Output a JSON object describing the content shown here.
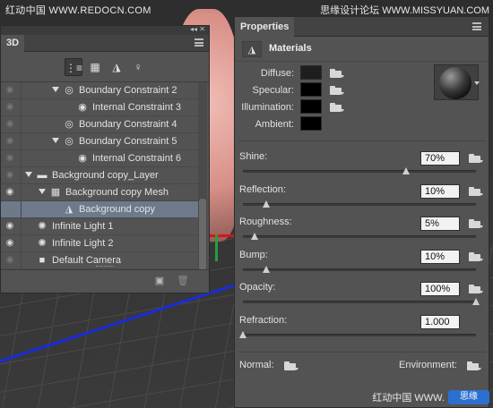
{
  "watermarks": {
    "top_left": "红动中国 WWW.REDOCN.COM",
    "top_right": "思缘设计论坛 WWW.MISSYUAN.COM",
    "bottom_right": "红动中国 WWW.",
    "bottom_badge": "思缘"
  },
  "panel3d": {
    "tab_label": "3D",
    "toolbar": [
      {
        "name": "scene-filter-icon",
        "glyph": "⋮≡"
      },
      {
        "name": "meshes-filter-icon",
        "glyph": "▦"
      },
      {
        "name": "materials-filter-icon",
        "glyph": "◮"
      },
      {
        "name": "lights-filter-icon",
        "glyph": "♀"
      }
    ],
    "rows": [
      {
        "label": "Boundary Constraint 2",
        "icon": "constraint-icon",
        "glyph": "◎",
        "expanded": true,
        "level": 2,
        "visible": false,
        "selected": false
      },
      {
        "label": "Internal Constraint 3",
        "icon": "constraint-icon",
        "glyph": "◉",
        "expanded": false,
        "level": 3,
        "visible": false,
        "selected": false
      },
      {
        "label": "Boundary Constraint 4",
        "icon": "constraint-icon",
        "glyph": "◎",
        "expanded": false,
        "level": 2,
        "visible": false,
        "selected": false
      },
      {
        "label": "Boundary Constraint 5",
        "icon": "constraint-icon",
        "glyph": "◎",
        "expanded": true,
        "level": 2,
        "visible": false,
        "selected": false
      },
      {
        "label": "Internal Constraint 6",
        "icon": "constraint-icon",
        "glyph": "◉",
        "expanded": false,
        "level": 3,
        "visible": false,
        "selected": false
      },
      {
        "label": "Background copy_Layer",
        "icon": "folder-icon",
        "glyph": "▬",
        "expanded": true,
        "level": 0,
        "visible": false,
        "selected": false
      },
      {
        "label": "Background copy Mesh",
        "icon": "mesh-icon",
        "glyph": "▦",
        "expanded": true,
        "level": 1,
        "visible": true,
        "selected": false
      },
      {
        "label": "Background copy",
        "icon": "material-icon",
        "glyph": "◮",
        "expanded": false,
        "level": 2,
        "visible": false,
        "selected": true
      },
      {
        "label": "Infinite Light 1",
        "icon": "light-icon",
        "glyph": "✺",
        "expanded": false,
        "level": 0,
        "visible": true,
        "selected": false
      },
      {
        "label": "Infinite Light 2",
        "icon": "light-icon",
        "glyph": "✺",
        "expanded": false,
        "level": 0,
        "visible": true,
        "selected": false
      },
      {
        "label": "Default Camera",
        "icon": "camera-icon",
        "glyph": "■",
        "expanded": false,
        "level": 0,
        "visible": false,
        "selected": false
      }
    ],
    "footer": {
      "new_glyph": "▣",
      "delete_glyph": "🗑"
    }
  },
  "properties": {
    "tab_label": "Properties",
    "header_title": "Materials",
    "header_glyph": "◮",
    "colors": [
      {
        "label": "Diffuse:",
        "swatch": "#1e1e1e"
      },
      {
        "label": "Specular:",
        "swatch": "#000000"
      },
      {
        "label": "Illumination:",
        "swatch": "#000000"
      },
      {
        "label": "Ambient:",
        "swatch": "#000000"
      }
    ],
    "sliders": [
      {
        "label": "Shine:",
        "value": "70%",
        "fraction": 0.7,
        "has_folder": true
      },
      {
        "label": "Reflection:",
        "value": "10%",
        "fraction": 0.1,
        "has_folder": true
      },
      {
        "label": "Roughness:",
        "value": "5%",
        "fraction": 0.05,
        "has_folder": true
      },
      {
        "label": "Bump:",
        "value": "10%",
        "fraction": 0.1,
        "has_folder": true
      },
      {
        "label": "Opacity:",
        "value": "100%",
        "fraction": 1.0,
        "has_folder": true
      },
      {
        "label": "Refraction:",
        "value": "1.000",
        "fraction": 0.0,
        "has_folder": false
      }
    ],
    "normal_label": "Normal:",
    "environment_label": "Environment:"
  }
}
